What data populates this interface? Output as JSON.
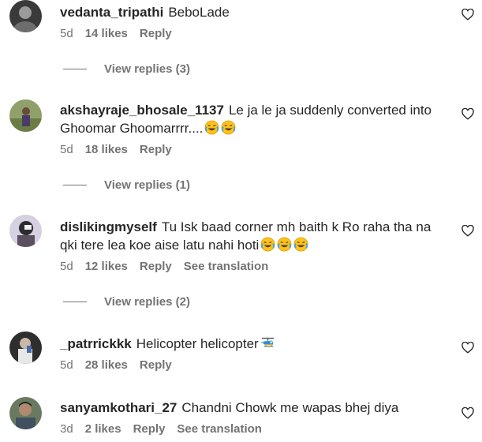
{
  "comments": [
    {
      "username": "vedanta_tripathi",
      "text": "BeboLade",
      "time": "5d",
      "likes": "14 likes",
      "reply": "Reply",
      "view_replies": "View replies (3)"
    },
    {
      "username": "akshayraje_bhosale_1137",
      "text": "Le ja le ja suddenly converted into Ghoomar Ghoomarrrr....",
      "time": "5d",
      "likes": "18 likes",
      "reply": "Reply",
      "view_replies": "View replies (1)"
    },
    {
      "username": "dislikingmyself",
      "text": "Tu Isk baad corner mh baith k Ro raha tha na qki tere lea koe aise latu nahi hoti",
      "time": "5d",
      "likes": "12 likes",
      "reply": "Reply",
      "see_translation": "See translation",
      "view_replies": "View replies (2)"
    },
    {
      "username": "_patrrickkk",
      "text": "Helicopter helicopter",
      "time": "5d",
      "likes": "28 likes",
      "reply": "Reply"
    },
    {
      "username": "sanyamkothari_27",
      "text": "Chandni Chowk me wapas bhej diya",
      "time": "3d",
      "likes": "2 likes",
      "reply": "Reply",
      "see_translation": "See translation"
    }
  ],
  "icons": {
    "like": "heart-outline-icon",
    "laugh": "face-with-tears-of-joy-emoji",
    "helicopter": "helicopter-emoji"
  },
  "colors": {
    "text": "#262626",
    "secondary": "#737373",
    "background": "#ffffff"
  }
}
